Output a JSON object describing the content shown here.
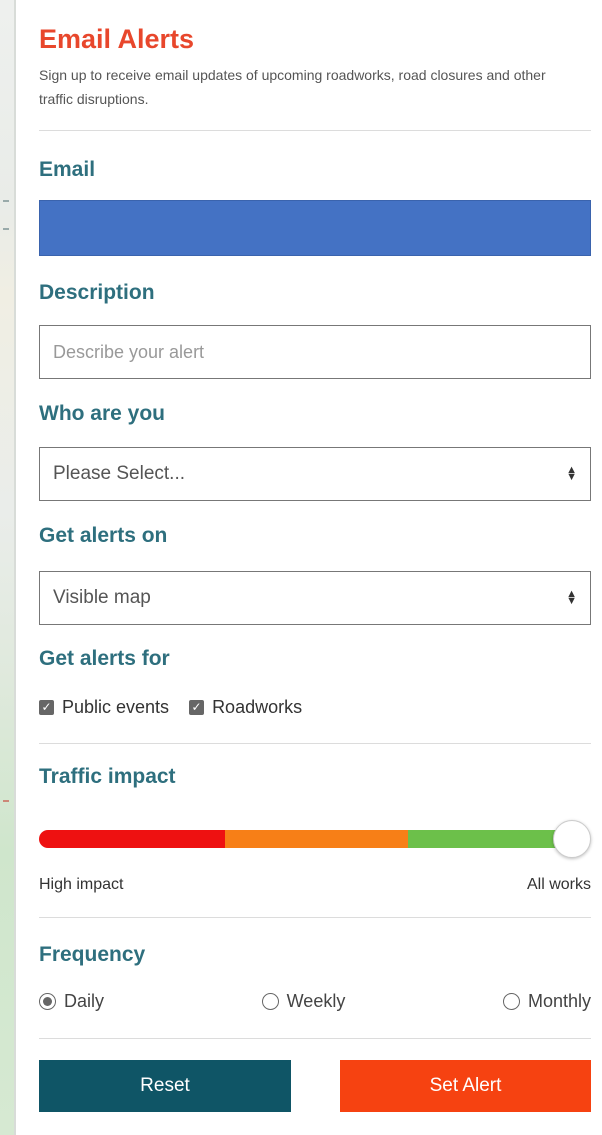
{
  "panel": {
    "title": "Email Alerts",
    "subtitle": "Sign up to receive email updates of upcoming roadworks, road closures and other traffic disruptions."
  },
  "email": {
    "label": "Email",
    "value": ""
  },
  "description": {
    "label": "Description",
    "placeholder": "Describe your alert"
  },
  "who": {
    "label": "Who are you",
    "selected": "Please Select..."
  },
  "alerts_on": {
    "label": "Get alerts on",
    "selected": "Visible map"
  },
  "alerts_for": {
    "label": "Get alerts for",
    "options": [
      {
        "label": "Public events",
        "checked": true
      },
      {
        "label": "Roadworks",
        "checked": true
      }
    ]
  },
  "traffic_impact": {
    "label": "Traffic impact",
    "min_label": "High impact",
    "max_label": "All works",
    "value_fraction": 1.0,
    "colors": {
      "high": "#ee1111",
      "medium": "#f77f17",
      "low": "#6cc04a"
    }
  },
  "frequency": {
    "label": "Frequency",
    "options": [
      {
        "label": "Daily",
        "selected": true
      },
      {
        "label": "Weekly",
        "selected": false
      },
      {
        "label": "Monthly",
        "selected": false
      }
    ]
  },
  "buttons": {
    "reset": "Reset",
    "set_alert": "Set Alert"
  },
  "colors": {
    "title": "#e8472c",
    "labels": "#2e6f7e",
    "reset_button": "#0f5566",
    "set_alert_button": "#f64211",
    "email_field": "#4472c4"
  }
}
